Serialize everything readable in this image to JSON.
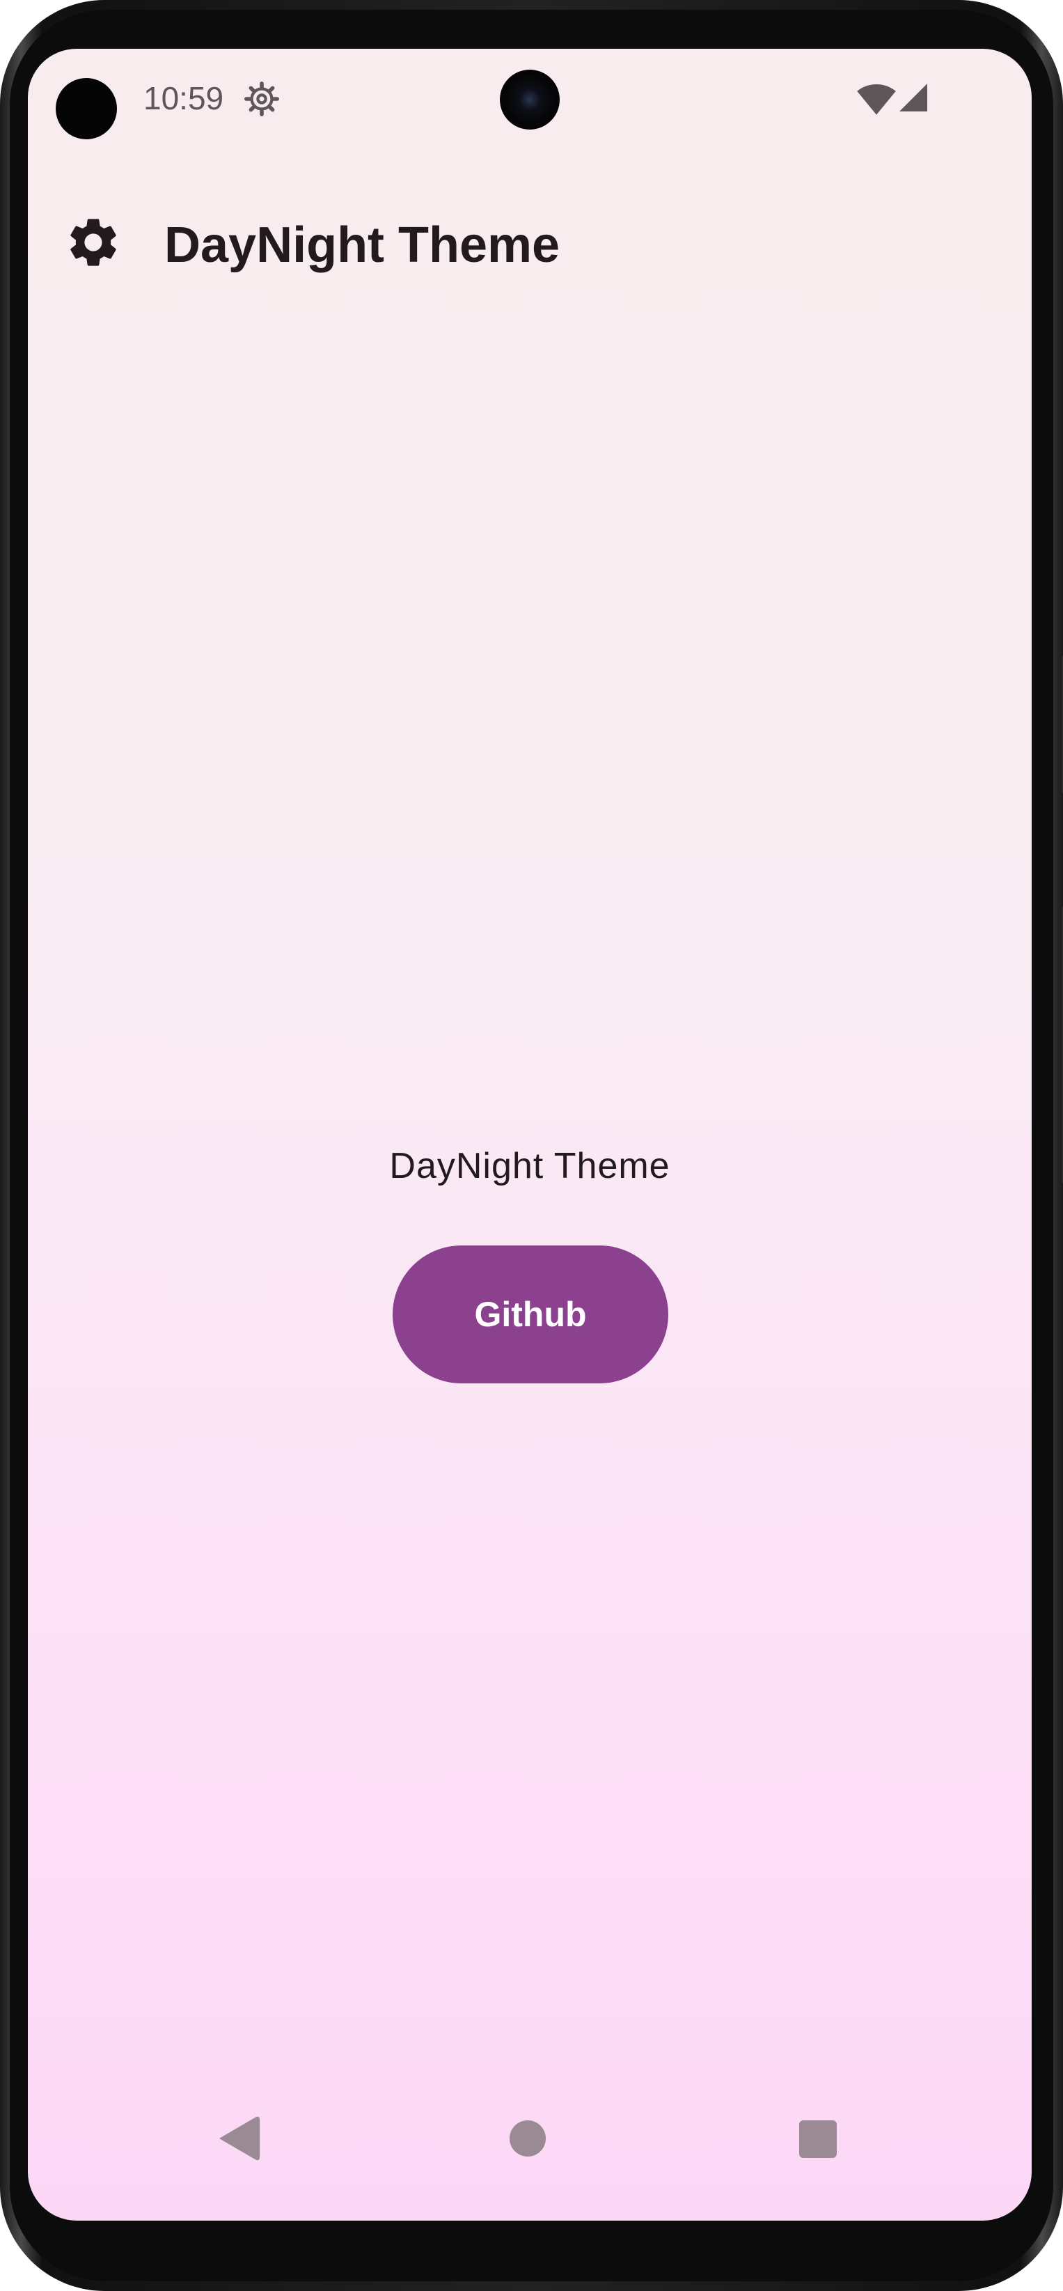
{
  "status_bar": {
    "time": "10:59",
    "icons": [
      "gear-icon",
      "wifi-icon",
      "cell-signal-icon"
    ]
  },
  "app_bar": {
    "title": "DayNight Theme",
    "leading_icon": "gear-icon"
  },
  "content": {
    "label": "DayNight Theme",
    "github_button_label": "Github"
  },
  "nav_bar": {
    "icons": [
      "back-icon",
      "home-icon",
      "recents-icon"
    ]
  },
  "colors": {
    "primary": "#8b418e",
    "on_primary": "#ffffff",
    "text": "#231a1e",
    "background_top": "#f8ecee",
    "background_bottom": "#fcd8f6"
  }
}
